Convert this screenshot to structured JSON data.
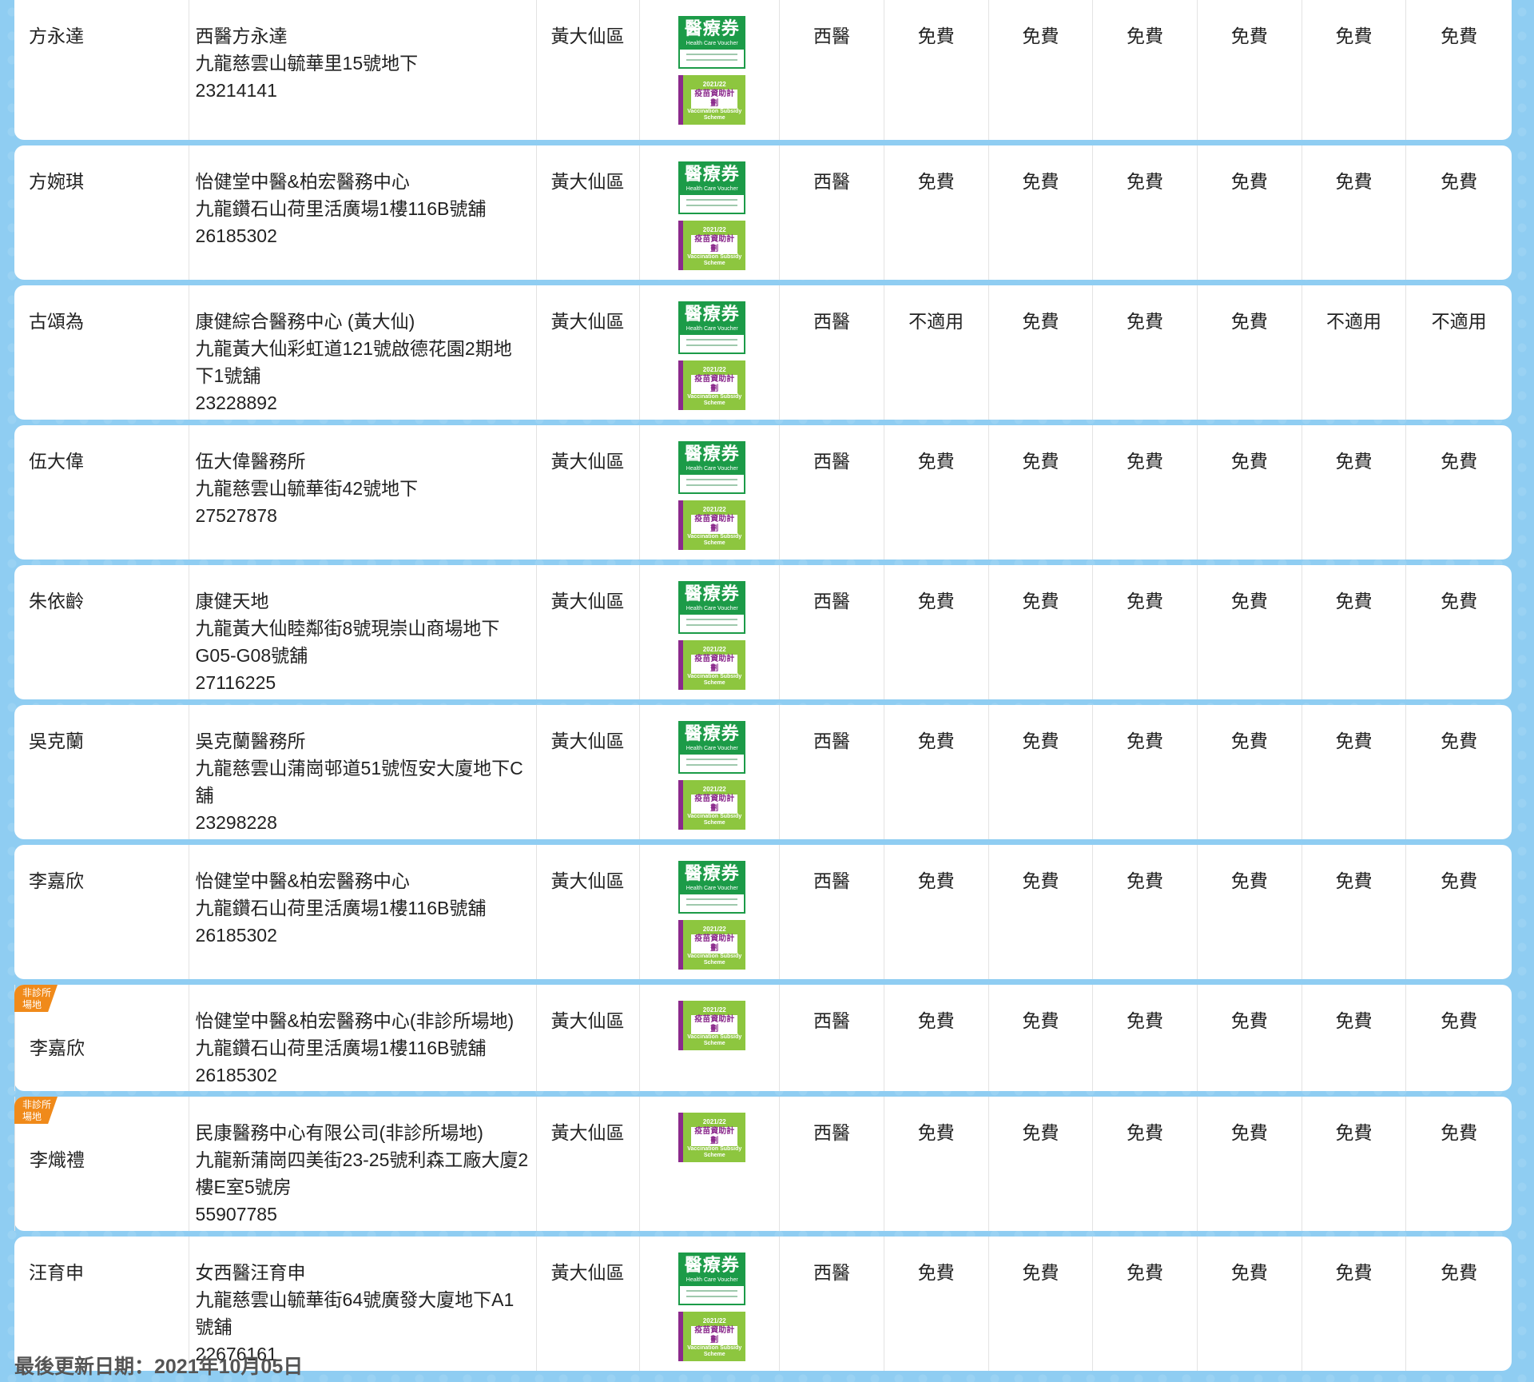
{
  "logos": {
    "hcv_title": "醫療券",
    "hcv_sub": "Health Care Voucher",
    "vss_year": "2021/22",
    "vss_title": "疫苗資助計劃",
    "vss_en": "Vaccination Subsidy Scheme"
  },
  "rows": [
    {
      "name": "方永達",
      "clinic": "西醫方永達",
      "address": "九龍慈雲山毓華里15號地下",
      "phone": "23214141",
      "district": "黃大仙區",
      "type": "西醫",
      "fees": [
        "免費",
        "免費",
        "免費",
        "免費",
        "免費",
        "免費"
      ],
      "tag": "",
      "hcv": true
    },
    {
      "name": "方婉琪",
      "clinic": "怡健堂中醫&柏宏醫務中心",
      "address": "九龍鑽石山荷里活廣場1樓116B號舖",
      "phone": "26185302",
      "district": "黃大仙區",
      "type": "西醫",
      "fees": [
        "免費",
        "免費",
        "免費",
        "免費",
        "免費",
        "免費"
      ],
      "tag": "",
      "hcv": true
    },
    {
      "name": "古頌為",
      "clinic": "康健綜合醫務中心 (黃大仙)",
      "address": "九龍黃大仙彩虹道121號啟德花園2期地下1號舖",
      "phone": "23228892",
      "district": "黃大仙區",
      "type": "西醫",
      "fees": [
        "不適用",
        "免費",
        "免費",
        "免費",
        "不適用",
        "不適用"
      ],
      "tag": "",
      "hcv": true
    },
    {
      "name": "伍大偉",
      "clinic": "伍大偉醫務所",
      "address": "九龍慈雲山毓華街42號地下",
      "phone": "27527878",
      "district": "黃大仙區",
      "type": "西醫",
      "fees": [
        "免費",
        "免費",
        "免費",
        "免費",
        "免費",
        "免費"
      ],
      "tag": "",
      "hcv": true
    },
    {
      "name": "朱依齡",
      "clinic": "康健天地",
      "address": "九龍黃大仙睦鄰街8號現崇山商場地下G05-G08號舖",
      "phone": "27116225",
      "district": "黃大仙區",
      "type": "西醫",
      "fees": [
        "免費",
        "免費",
        "免費",
        "免費",
        "免費",
        "免費"
      ],
      "tag": "",
      "hcv": true
    },
    {
      "name": "吳克蘭",
      "clinic": "吳克蘭醫務所",
      "address": "九龍慈雲山蒲崗邨道51號恆安大廈地下C舖",
      "phone": "23298228",
      "district": "黃大仙區",
      "type": "西醫",
      "fees": [
        "免費",
        "免費",
        "免費",
        "免費",
        "免費",
        "免費"
      ],
      "tag": "",
      "hcv": true
    },
    {
      "name": "李嘉欣",
      "clinic": "怡健堂中醫&柏宏醫務中心",
      "address": "九龍鑽石山荷里活廣場1樓116B號舖",
      "phone": "26185302",
      "district": "黃大仙區",
      "type": "西醫",
      "fees": [
        "免費",
        "免費",
        "免費",
        "免費",
        "免費",
        "免費"
      ],
      "tag": "",
      "hcv": true
    },
    {
      "name": "李嘉欣",
      "clinic": "怡健堂中醫&柏宏醫務中心(非診所場地)",
      "address": "九龍鑽石山荷里活廣場1樓116B號舖",
      "phone": "26185302",
      "district": "黃大仙區",
      "type": "西醫",
      "fees": [
        "免費",
        "免費",
        "免費",
        "免費",
        "免費",
        "免費"
      ],
      "tag": "非診所場地",
      "hcv": false
    },
    {
      "name": "李熾禮",
      "clinic": "民康醫務中心有限公司(非診所場地)",
      "address": "九龍新蒲崗四美街23-25號利森工廠大廈2樓E室5號房",
      "phone": "55907785",
      "district": "黃大仙區",
      "type": "西醫",
      "fees": [
        "免費",
        "免費",
        "免費",
        "免費",
        "免費",
        "免費"
      ],
      "tag": "非診所場地",
      "hcv": false
    },
    {
      "name": "汪育申",
      "clinic": "女西醫汪育申",
      "address": "九龍慈雲山毓華街64號廣發大廈地下A1號舖",
      "phone": "22676161",
      "district": "黃大仙區",
      "type": "西醫",
      "fees": [
        "免費",
        "免費",
        "免費",
        "免費",
        "免費",
        "免費"
      ],
      "tag": "",
      "hcv": true
    }
  ],
  "footer": {
    "last_updated": "最後更新日期：2021年10月05日"
  }
}
